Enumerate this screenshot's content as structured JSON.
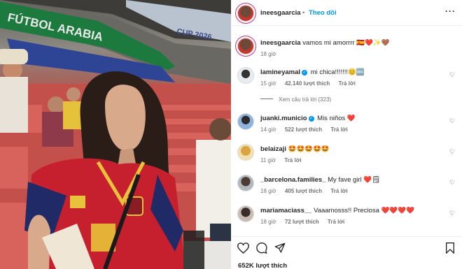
{
  "post": {
    "username": "ineesgaarcia",
    "follow_label": "Theo dõi",
    "caption_user": "ineesgaarcia",
    "caption_text": "vamos mi amorrrr 🇪🇸❤️✨🤎",
    "caption_time": "18 giờ",
    "likes": "652K lượt thích",
    "photo_text": {
      "stadium_banner": "FÚTBOL ARABIA",
      "cup_banner": "CUP 2026"
    }
  },
  "comments": [
    {
      "user": "lamineyamal",
      "verified": true,
      "text": "mi chica!!!!!!!😊🔤",
      "time": "15 giờ",
      "likes": "42.140 lượt thích",
      "reply": "Trả lời",
      "view_replies": "Xem câu trả lời (323)"
    },
    {
      "user": "juanki.municio",
      "verified": true,
      "text": "Mis niños ❤️",
      "time": "14 giờ",
      "likes": "522 lượt thích",
      "reply": "Trả lời"
    },
    {
      "user": "belaizaji",
      "verified": false,
      "text": "🤩🤩🤩🤩🤩",
      "time": "11 giờ",
      "likes": "",
      "reply": "Trả lời"
    },
    {
      "user": "_barcelona.families_",
      "verified": false,
      "text": "My fave girl ❤️🗒",
      "time": "18 giờ",
      "likes": "405 lượt thích",
      "reply": "Trả lời"
    },
    {
      "user": "mariamaciass__",
      "verified": false,
      "text": "Vaaamosss!! Preciosa ❤️❤️❤️❤️",
      "time": "18 giờ",
      "likes": "72 lượt thích",
      "reply": "Trả lời"
    }
  ],
  "icons": {
    "more": "more-options-icon",
    "like": "heart-icon",
    "comment": "comment-icon",
    "share": "share-icon",
    "save": "bookmark-icon"
  }
}
